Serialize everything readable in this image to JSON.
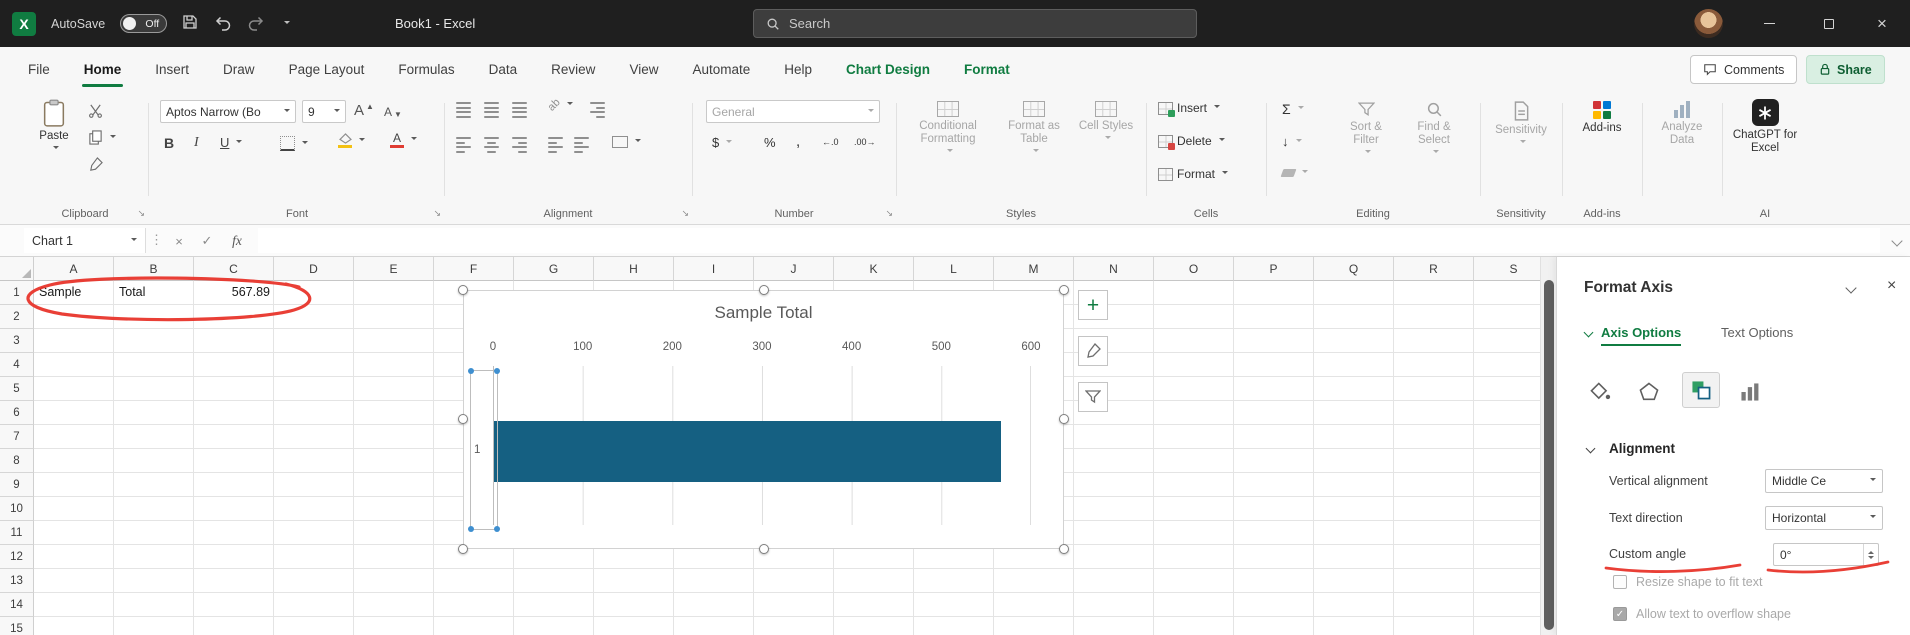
{
  "titlebar": {
    "app_logo": "X",
    "autosave_label": "AutoSave",
    "autosave_state": "Off",
    "doc_title": "Book1 - Excel",
    "search_placeholder": "Search"
  },
  "ribbon_tabs": {
    "items": [
      {
        "label": "File"
      },
      {
        "label": "Home",
        "state": "active"
      },
      {
        "label": "Insert"
      },
      {
        "label": "Draw"
      },
      {
        "label": "Page Layout"
      },
      {
        "label": "Formulas"
      },
      {
        "label": "Data"
      },
      {
        "label": "Review"
      },
      {
        "label": "View"
      },
      {
        "label": "Automate"
      },
      {
        "label": "Help"
      },
      {
        "label": "Chart Design",
        "state": "contextual"
      },
      {
        "label": "Format",
        "state": "contextual"
      }
    ],
    "comments_label": "Comments",
    "share_label": "Share"
  },
  "ribbon": {
    "clipboard": {
      "paste_label": "Paste",
      "group_label": "Clipboard"
    },
    "font": {
      "font_name": "Aptos Narrow (Bo",
      "font_size": "9",
      "bold": "B",
      "italic": "I",
      "underline": "U",
      "grow_letter": "A",
      "shrink_letter": "A",
      "color_letter": "A",
      "group_label": "Font"
    },
    "alignment": {
      "orientation_glyph": "ab",
      "group_label": "Alignment"
    },
    "number": {
      "format": "General",
      "currency": "$",
      "percent": "%",
      "comma": ",",
      "increase_decimal": "←.0",
      "decrease_decimal": ".00→",
      "group_label": "Number"
    },
    "styles": {
      "conditional_label": "Conditional Formatting",
      "table_label": "Format as Table",
      "cellstyles_label": "Cell Styles",
      "group_label": "Styles"
    },
    "cells": {
      "insert_label": "Insert",
      "delete_label": "Delete",
      "format_label": "Format",
      "group_label": "Cells"
    },
    "editing": {
      "sum_glyph": "Σ",
      "fill_glyph": "↓",
      "sort_label": "Sort & Filter",
      "find_label": "Find & Select",
      "group_label": "Editing"
    },
    "sensitivity": {
      "label": "Sensitivity",
      "group_label": "Sensitivity"
    },
    "addins": {
      "label": "Add-ins",
      "group_label": "Add-ins"
    },
    "analyze": {
      "label": "Analyze Data"
    },
    "ai": {
      "label": "ChatGPT for Excel",
      "group_label": "AI"
    }
  },
  "formula_bar": {
    "name_box": "Chart 1",
    "fx_label": "fx"
  },
  "glyphs": {
    "close": "×",
    "check": "✓",
    "dots": "⋮",
    "plus": "+"
  },
  "sheet": {
    "columns": [
      "A",
      "B",
      "C",
      "D",
      "E",
      "F",
      "G",
      "H",
      "I",
      "J",
      "K",
      "L",
      "M",
      "N",
      "O",
      "P",
      "Q",
      "R",
      "S"
    ],
    "rows": [
      "1",
      "2",
      "3",
      "4",
      "5",
      "6",
      "7",
      "8",
      "9",
      "10",
      "11",
      "12",
      "13",
      "14",
      "15"
    ],
    "cells": {
      "A1": "Sample",
      "B1": "Total",
      "C1": "567.89"
    }
  },
  "chart_data": {
    "type": "bar",
    "orientation": "horizontal",
    "title": "Sample Total",
    "categories": [
      "1"
    ],
    "series": [
      {
        "name": "Total",
        "values": [
          567.89
        ]
      }
    ],
    "values": [
      567.89
    ],
    "x_ticks": [
      "0",
      "100",
      "200",
      "300",
      "400",
      "500",
      "600"
    ],
    "xlim": [
      0,
      600
    ],
    "bar_color": "#156082",
    "grid": true,
    "legend": false
  },
  "pane": {
    "title": "Format Axis",
    "tab_axis": "Axis Options",
    "tab_text": "Text Options",
    "section_label": "Alignment",
    "vertical_alignment": {
      "label": "Vertical alignment",
      "value": "Middle Ce"
    },
    "text_direction": {
      "label": "Text direction",
      "value": "Horizontal"
    },
    "custom_angle": {
      "label": "Custom angle",
      "value": "0°"
    },
    "resize_shape": {
      "label": "Resize shape to fit text",
      "checked": false
    },
    "overflow": {
      "label": "Allow text to overflow shape",
      "checked": true
    }
  },
  "colors": {
    "excel_green": "#107C41",
    "bar_teal": "#156082",
    "annotation_red": "#E8352B"
  }
}
